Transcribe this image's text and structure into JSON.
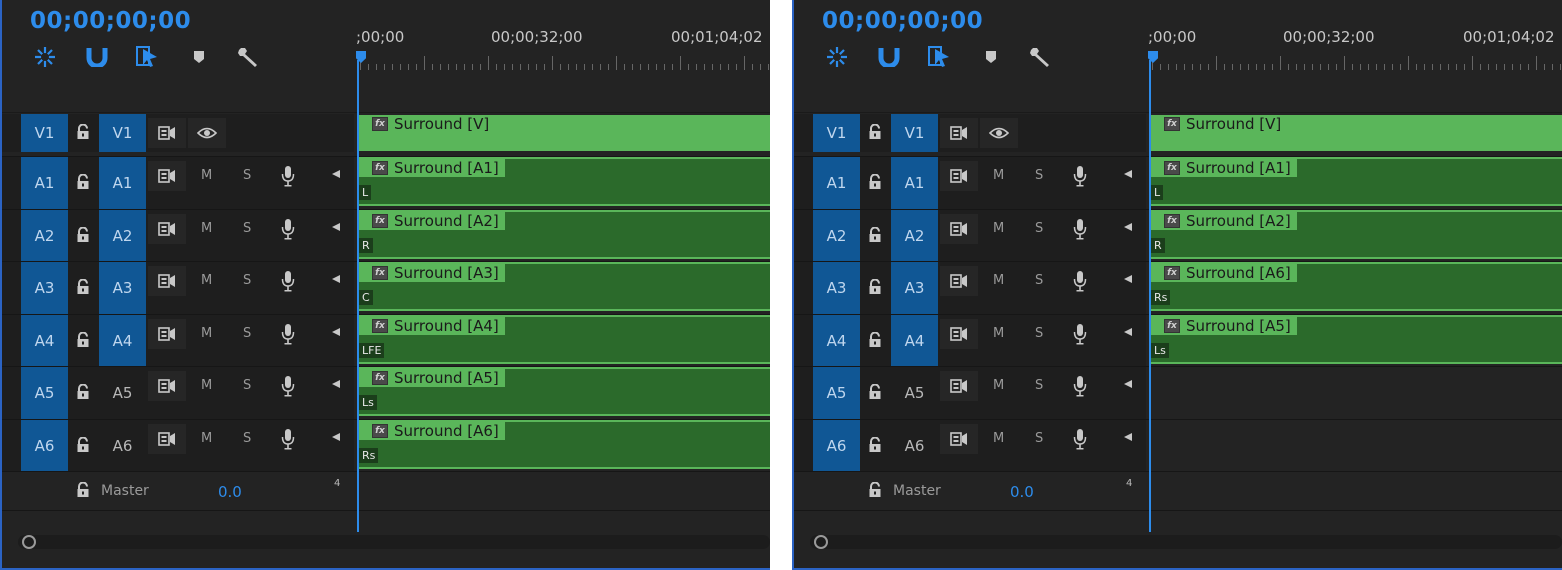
{
  "panels": [
    {
      "timecode": "00;00;00;00",
      "ruler": [
        ";00;00",
        "00;00;32;00",
        "00;01;04;02"
      ],
      "video_track": {
        "source": "V1",
        "target": "V1",
        "clip": "Surround [V]"
      },
      "audio_tracks": [
        {
          "source": "A1",
          "target": "A1",
          "target_active": true,
          "mute": "M",
          "solo": "S",
          "clip": "Surround [A1]",
          "channel": "L"
        },
        {
          "source": "A2",
          "target": "A2",
          "target_active": true,
          "mute": "M",
          "solo": "S",
          "clip": "Surround [A2]",
          "channel": "R"
        },
        {
          "source": "A3",
          "target": "A3",
          "target_active": true,
          "mute": "M",
          "solo": "S",
          "clip": "Surround [A3]",
          "channel": "C"
        },
        {
          "source": "A4",
          "target": "A4",
          "target_active": true,
          "mute": "M",
          "solo": "S",
          "clip": "Surround [A4]",
          "channel": "LFE"
        },
        {
          "source": "A5",
          "target": "A5",
          "target_active": false,
          "mute": "M",
          "solo": "S",
          "clip": "Surround [A5]",
          "channel": "Ls"
        },
        {
          "source": "A6",
          "target": "A6",
          "target_active": false,
          "mute": "M",
          "solo": "S",
          "clip": "Surround [A6]",
          "channel": "Rs"
        }
      ],
      "master": {
        "label": "Master",
        "value": "0.0",
        "channels": "4"
      }
    },
    {
      "timecode": "00;00;00;00",
      "ruler": [
        ";00;00",
        "00;00;32;00",
        "00;01;04;02"
      ],
      "video_track": {
        "source": "V1",
        "target": "V1",
        "clip": "Surround [V]"
      },
      "audio_tracks": [
        {
          "source": "A1",
          "target": "A1",
          "target_active": true,
          "mute": "M",
          "solo": "S",
          "clip": "Surround [A1]",
          "channel": "L"
        },
        {
          "source": "A2",
          "target": "A2",
          "target_active": true,
          "mute": "M",
          "solo": "S",
          "clip": "Surround [A2]",
          "channel": "R"
        },
        {
          "source": "A3",
          "target": "A3",
          "target_active": true,
          "mute": "M",
          "solo": "S",
          "clip": "Surround [A6]",
          "channel": "Rs"
        },
        {
          "source": "A4",
          "target": "A4",
          "target_active": true,
          "mute": "M",
          "solo": "S",
          "clip": "Surround [A5]",
          "channel": "Ls"
        },
        {
          "source": "A5",
          "target": "A5",
          "target_active": false,
          "mute": "M",
          "solo": "S",
          "clip": "",
          "channel": ""
        },
        {
          "source": "A6",
          "target": "A6",
          "target_active": false,
          "mute": "M",
          "solo": "S",
          "clip": "",
          "channel": ""
        }
      ],
      "master": {
        "label": "Master",
        "value": "0.0",
        "channels": "4"
      }
    }
  ],
  "colors": {
    "accent": "#2d8ceb",
    "track_blue": "#105795",
    "clip_video": "#5ab65a",
    "clip_audio": "#2b6a2b"
  },
  "icons": [
    "ripple-edit-icon",
    "snap-magnet-icon",
    "linked-selection-icon",
    "add-marker-icon",
    "wrench-settings-icon",
    "lock-icon",
    "sync-lock-icon",
    "eye-icon",
    "microphone-icon",
    "speaker-icon"
  ]
}
